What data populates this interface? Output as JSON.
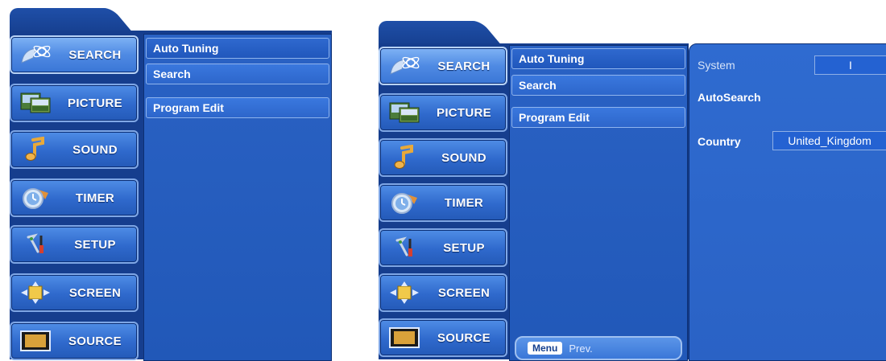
{
  "menus": [
    {
      "nav": [
        {
          "label": "SEARCH",
          "icon": "satellite-icon",
          "active": true
        },
        {
          "label": "PICTURE",
          "icon": "picture-icon",
          "active": false
        },
        {
          "label": "SOUND",
          "icon": "music-note-icon",
          "active": false
        },
        {
          "label": "TIMER",
          "icon": "clock-icon",
          "active": false
        },
        {
          "label": "SETUP",
          "icon": "tools-icon",
          "active": false
        },
        {
          "label": "SCREEN",
          "icon": "screen-arrows-icon",
          "active": false
        },
        {
          "label": "SOURCE",
          "icon": "source-input-icon",
          "active": false
        }
      ],
      "submenu": [
        {
          "label": "Auto Tuning"
        },
        {
          "label": "Search"
        },
        {
          "label": "Program Edit"
        }
      ]
    },
    {
      "nav": [
        {
          "label": "SEARCH",
          "icon": "satellite-icon",
          "active": true
        },
        {
          "label": "PICTURE",
          "icon": "picture-icon",
          "active": false
        },
        {
          "label": "SOUND",
          "icon": "music-note-icon",
          "active": false
        },
        {
          "label": "TIMER",
          "icon": "clock-icon",
          "active": false
        },
        {
          "label": "SETUP",
          "icon": "tools-icon",
          "active": false
        },
        {
          "label": "SCREEN",
          "icon": "screen-arrows-icon",
          "active": false
        },
        {
          "label": "SOURCE",
          "icon": "source-input-icon",
          "active": false
        }
      ],
      "submenu": [
        {
          "label": "Auto Tuning"
        },
        {
          "label": "Search"
        },
        {
          "label": "Program Edit"
        }
      ],
      "detail": {
        "system_label": "System",
        "system_value": "I",
        "autosearch_label": "AutoSearch",
        "country_label": "Country",
        "country_value": "United_Kingdom"
      },
      "footer": {
        "key": "Menu",
        "label": "Prev."
      }
    }
  ],
  "colors": {
    "frame": "#163e8e",
    "button": "#2f69cc",
    "active_button": "#4f8ae3",
    "panel": "#2a62c5",
    "text": "#ffffff"
  }
}
